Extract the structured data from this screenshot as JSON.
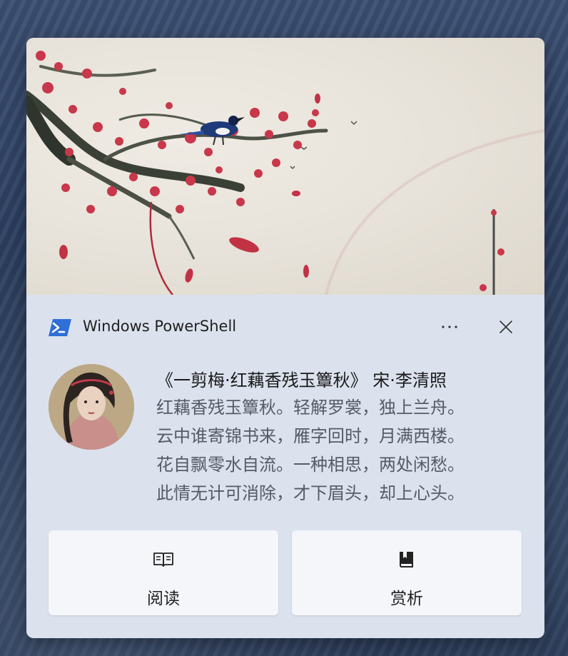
{
  "notification": {
    "app_name": "Windows PowerShell",
    "title": "《一剪梅·红藕香残玉簟秋》 宋·李清照",
    "lines": [
      "红藕香残玉簟秋。轻解罗裳，独上兰舟。",
      "云中谁寄锦书来，雁字回时，月满西楼。",
      "花自飘零水自流。一种相思，两处闲愁。",
      "此情无计可消除，才下眉头，却上心头。"
    ],
    "actions": [
      {
        "label": "阅读",
        "icon": "open-book-icon"
      },
      {
        "label": "赏析",
        "icon": "closed-book-icon"
      }
    ],
    "hero_image": "plum-blossom-magpie-painting",
    "avatar_image": "portrait-avatar"
  },
  "colors": {
    "toast_background": "#dbe2ee",
    "button_background": "#f4f6fa",
    "powershell_blue": "#2f6fd6",
    "blossom_red": "#c9374a"
  }
}
